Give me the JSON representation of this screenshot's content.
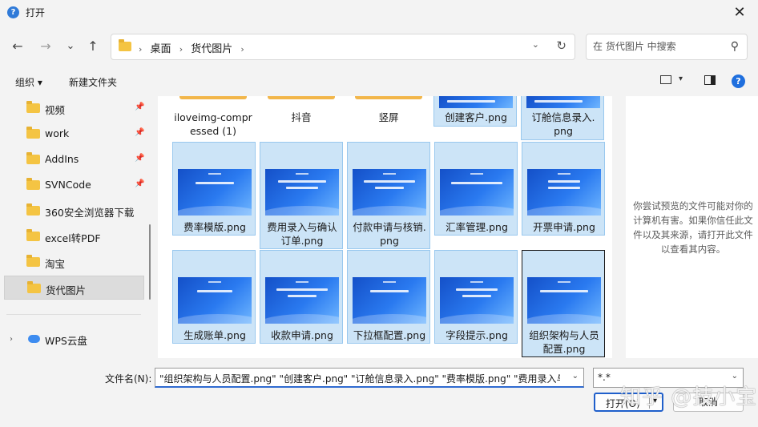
{
  "window": {
    "title": "打开",
    "close_glyph": "✕"
  },
  "nav": {
    "back": "←",
    "forward": "→",
    "recent": "⌄",
    "up": "↑"
  },
  "address": {
    "crumbs": [
      "桌面",
      "货代图片"
    ],
    "separator": "›",
    "dropdown": "⌄",
    "refresh": "↻"
  },
  "search": {
    "placeholder": "在 货代图片 中搜索",
    "icon": "search-icon"
  },
  "toolbar": {
    "organize": "组织 ▾",
    "new_folder": "新建文件夹",
    "help": "?"
  },
  "sidebar": {
    "items": [
      {
        "label": "视频",
        "pinned": true
      },
      {
        "label": "work",
        "pinned": true
      },
      {
        "label": "AddIns",
        "pinned": true
      },
      {
        "label": "SVNCode",
        "pinned": true
      },
      {
        "label": "360安全浏览器下载",
        "pinned": false
      },
      {
        "label": "excel转PDF",
        "pinned": false
      },
      {
        "label": "淘宝",
        "pinned": false
      },
      {
        "label": "货代图片",
        "pinned": false,
        "selected": true
      }
    ],
    "cloud": {
      "label": "WPS云盘",
      "chevron": "›"
    }
  },
  "files": {
    "row0": [
      {
        "label": "iloveimg-compr\nessed (1)",
        "kind": "folder"
      },
      {
        "label": "抖音",
        "kind": "folder"
      },
      {
        "label": "竖屏",
        "kind": "folder"
      },
      {
        "label": "创建客户.png",
        "kind": "image",
        "selected": true
      },
      {
        "label": "订舱信息录入.\npng",
        "kind": "image",
        "selected": true
      }
    ],
    "row1": [
      {
        "label": "费率模版.png",
        "selected": true
      },
      {
        "label": "费用录入与确认\n订单.png",
        "selected": true
      },
      {
        "label": "付款申请与核销.\npng",
        "selected": true
      },
      {
        "label": "汇率管理.png",
        "selected": true
      },
      {
        "label": "开票申请.png",
        "selected": true
      }
    ],
    "row2": [
      {
        "label": "生成账单.png",
        "selected": true
      },
      {
        "label": "收款申请.png",
        "selected": true
      },
      {
        "label": "下拉框配置.png",
        "selected": true
      },
      {
        "label": "字段提示.png",
        "selected": true
      },
      {
        "label": "组织架构与人员\n配置.png",
        "selected": true,
        "focused": true
      }
    ]
  },
  "preview": {
    "message": "你尝试预览的文件可能对你的计算机有害。如果你信任此文件以及其来源，请打开此文件以查看其内容。"
  },
  "footer": {
    "filename_label": "文件名(N):",
    "filename_value": "\"组织架构与人员配置.png\" \"创建客户.png\" \"订舱信息录入.png\" \"费率模版.png\" \"费用录入与确",
    "filetype_value": "*.*",
    "open_label": "打开(O)",
    "cancel_label": "取消",
    "watermark": "知乎 @技小宝"
  },
  "colors": {
    "accent": "#1f5fcb",
    "selection": "#cce4f7",
    "folder": "#f4c443"
  }
}
